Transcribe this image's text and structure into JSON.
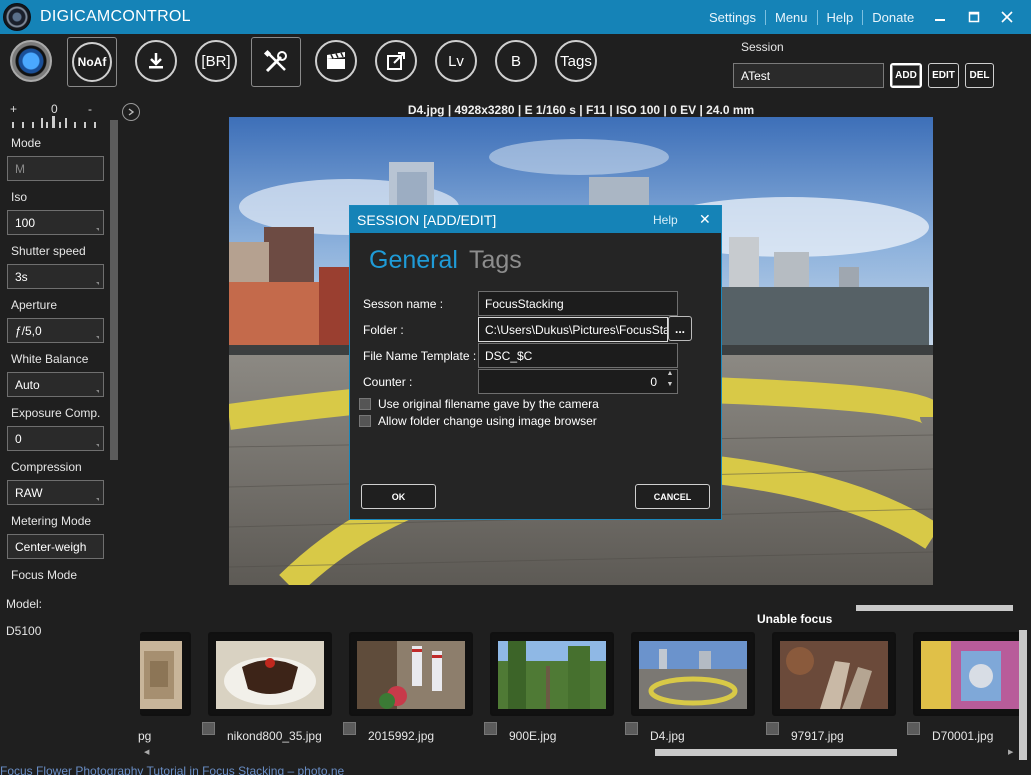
{
  "app": {
    "title": "DIGICAMCONTROL",
    "menu": [
      "Settings",
      "Menu",
      "Help",
      "Donate"
    ]
  },
  "toolbar": {
    "noaf_label": "NoAf",
    "br_label": "[BR]",
    "lv_label": "Lv",
    "b_label": "B",
    "tags_label": "Tags"
  },
  "session": {
    "label": "Session",
    "current": "ATest",
    "add_label": "ADD",
    "edit_label": "EDIT",
    "del_label": "DEL"
  },
  "camera": {
    "ev_plus": "+",
    "ev_zero": "0",
    "ev_minus": "-",
    "params": [
      {
        "label": "Mode",
        "value": "M"
      },
      {
        "label": "Iso",
        "value": "100"
      },
      {
        "label": "Shutter speed",
        "value": "3s"
      },
      {
        "label": "Aperture",
        "value": "ƒ/5,0"
      },
      {
        "label": "White Balance",
        "value": "Auto"
      },
      {
        "label": "Exposure Comp.",
        "value": "0"
      },
      {
        "label": "Compression",
        "value": "RAW"
      },
      {
        "label": "Metering Mode",
        "value": "Center-weigh"
      },
      {
        "label": "Focus Mode",
        "value": ""
      }
    ],
    "model_label": "Model:",
    "model_value": "D5100"
  },
  "preview": {
    "info": "D4.jpg | 4928x3280 | E 1/160 s | F11 | ISO 100 | 0 EV | 24.0 mm"
  },
  "dialog": {
    "title": "SESSION [ADD/EDIT]",
    "help": "Help",
    "close": "✕",
    "tab_general": "General",
    "tab_tags": "Tags",
    "session_name_label": "Sesson name :",
    "session_name_value": "FocusStacking",
    "folder_label": "Folder :",
    "folder_value": "C:\\Users\\Dukus\\Pictures\\FocusStac",
    "browse_label": "...",
    "template_label": "File Name Template :",
    "template_value": "DSC_$C",
    "counter_label": "Counter :",
    "counter_value": "0",
    "checkbox_original": "Use original filename gave by the camera",
    "checkbox_folder": "Allow folder change using image browser",
    "ok_label": "OK",
    "cancel_label": "CANCEL"
  },
  "focus": {
    "status": "Unable focus"
  },
  "thumbnails": [
    {
      "name": "pg"
    },
    {
      "name": "nikond800_35.jpg"
    },
    {
      "name": "2015992.jpg"
    },
    {
      "name": "900E.jpg"
    },
    {
      "name": "D4.jpg"
    },
    {
      "name": "97917.jpg"
    },
    {
      "name": "D70001.jpg"
    }
  ],
  "underlying_text": "Focus Flower Photography Tutorial in Focus Stacking – photo.ne",
  "colors": {
    "accent": "#1583b7",
    "tab_active": "#1f9bd7",
    "background": "#1f1f1f"
  }
}
